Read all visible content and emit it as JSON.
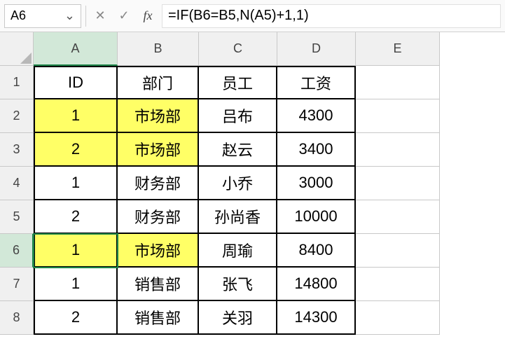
{
  "name_box": {
    "value": "A6"
  },
  "formula_bar": {
    "value": "=IF(B6=B5,N(A5)+1,1)"
  },
  "columns": [
    "A",
    "B",
    "C",
    "D",
    "E"
  ],
  "rows": [
    "1",
    "2",
    "3",
    "4",
    "5",
    "6",
    "7",
    "8"
  ],
  "active_cell": "A6",
  "active_col": "A",
  "active_row": "6",
  "headers": {
    "A": "ID",
    "B": "部门",
    "C": "员工",
    "D": "工资"
  },
  "data": [
    {
      "id": "1",
      "dept": "市场部",
      "emp": "吕布",
      "sal": "4300",
      "hl": true
    },
    {
      "id": "2",
      "dept": "市场部",
      "emp": "赵云",
      "sal": "3400",
      "hl": true
    },
    {
      "id": "1",
      "dept": "财务部",
      "emp": "小乔",
      "sal": "3000",
      "hl": false
    },
    {
      "id": "2",
      "dept": "财务部",
      "emp": "孙尚香",
      "sal": "10000",
      "hl": false
    },
    {
      "id": "1",
      "dept": "市场部",
      "emp": "周瑜",
      "sal": "8400",
      "hl": true
    },
    {
      "id": "1",
      "dept": "销售部",
      "emp": "张飞",
      "sal": "14800",
      "hl": false
    },
    {
      "id": "2",
      "dept": "销售部",
      "emp": "关羽",
      "sal": "14300",
      "hl": false
    }
  ],
  "icons": {
    "cancel": "✕",
    "enter": "✓",
    "fx": "fx",
    "caret": "⌄"
  }
}
